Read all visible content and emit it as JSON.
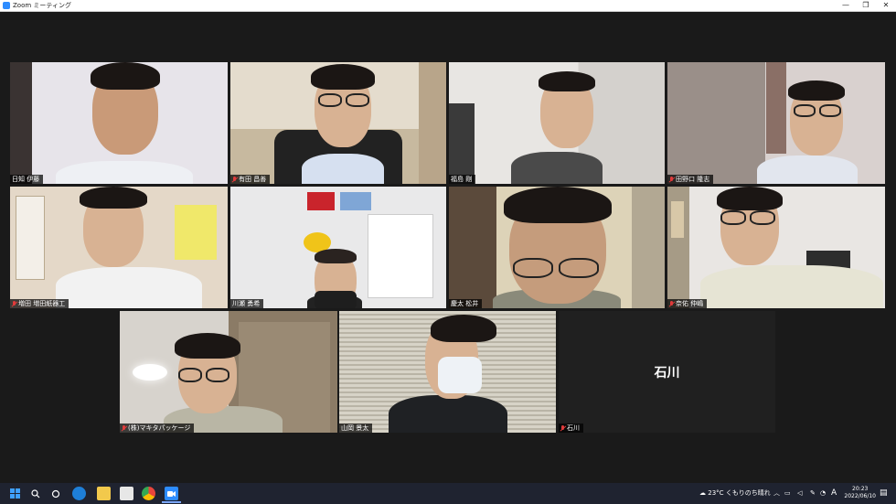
{
  "window": {
    "title": "Zoom ミーティング",
    "minimize": "—",
    "maximize": "❐",
    "close": "✕"
  },
  "participants": [
    {
      "name": "日知 伊藤",
      "muted": false
    },
    {
      "name": "有田 昌善",
      "muted": true
    },
    {
      "name": "福島 剛",
      "muted": false
    },
    {
      "name": "田野口 隆志",
      "muted": true
    },
    {
      "name": "増田 増田紙器工",
      "muted": true
    },
    {
      "name": "川瀬 勇希",
      "muted": false
    },
    {
      "name": "慶太 松井",
      "muted": false
    },
    {
      "name": "奈佑 仲嶋",
      "muted": true
    },
    {
      "name": "(株)マキタパッケージ",
      "muted": true
    },
    {
      "name": "山岡 景太",
      "muted": false
    },
    {
      "name": "石川",
      "muted": true,
      "display_name": "石川"
    }
  ],
  "taskbar": {
    "weather": "23°C くもりのち晴れ",
    "input_indicator": "A",
    "time": "20:23",
    "date": "2022/06/10",
    "icons": [
      "windows-start-icon",
      "search-icon",
      "task-view-icon",
      "edge-icon",
      "file-explorer-icon",
      "store-icon",
      "chrome-icon",
      "zoom-icon"
    ]
  }
}
